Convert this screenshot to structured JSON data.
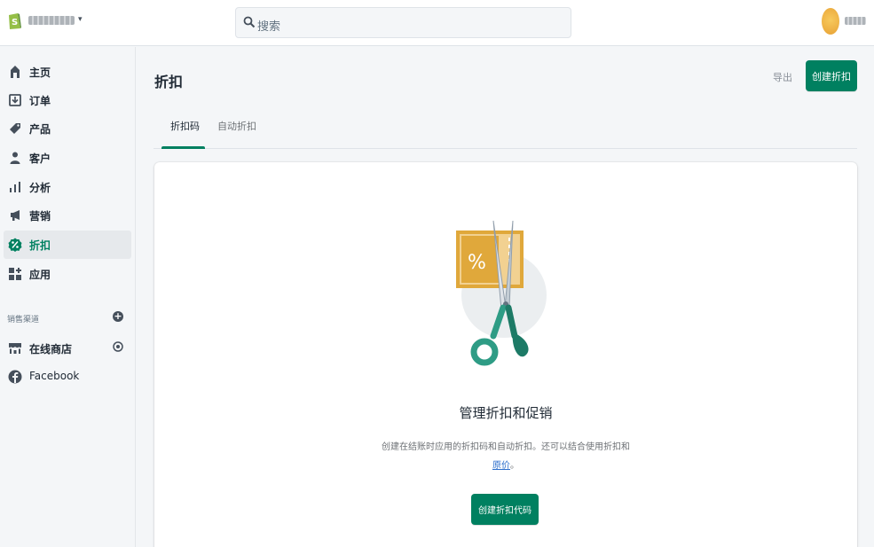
{
  "header": {
    "search_placeholder": "搜索",
    "store_caret": "▾"
  },
  "sidebar": {
    "items": [
      {
        "label": "主页",
        "icon": "home-icon"
      },
      {
        "label": "订单",
        "icon": "orders-icon"
      },
      {
        "label": "产品",
        "icon": "tag-icon"
      },
      {
        "label": "客户",
        "icon": "person-icon"
      },
      {
        "label": "分析",
        "icon": "bar-chart-icon"
      },
      {
        "label": "营销",
        "icon": "megaphone-icon"
      },
      {
        "label": "折扣",
        "icon": "discount-icon",
        "active": true
      },
      {
        "label": "应用",
        "icon": "apps-icon"
      }
    ],
    "channels_title": "销售渠道",
    "channels_add": "+",
    "channels": [
      {
        "label": "在线商店",
        "icon": "store-icon"
      },
      {
        "label": "Facebook",
        "icon": "facebook-icon"
      }
    ]
  },
  "page": {
    "title": "折扣",
    "export_label": "导出",
    "create_label": "创建折扣",
    "tabs": [
      "折扣码",
      "自动折扣"
    ]
  },
  "empty_state": {
    "title": "管理折扣和促销",
    "description": "创建在结账时应用的折扣码和自动折扣。还可以结合使用折扣和",
    "link_text": "原价",
    "link_suffix": "。",
    "button_label": "创建折扣代码"
  },
  "colors": {
    "brand_green": "#008060",
    "link_blue": "#2c6ecb",
    "illustration_orange": "#e0a83b",
    "illustration_teal": "#2e9c85"
  }
}
